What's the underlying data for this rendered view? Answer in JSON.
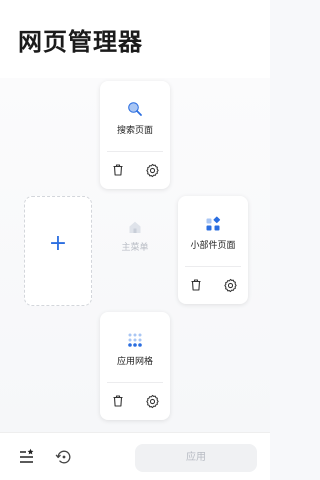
{
  "header": {
    "title": "网页管理器"
  },
  "cards": {
    "search": {
      "label": "搜索页面"
    },
    "widget": {
      "label": "小部件页面"
    },
    "appgrid": {
      "label": "应用网格"
    }
  },
  "home": {
    "label": "主菜单"
  },
  "add_slot": {
    "glyph": "+"
  },
  "bottom_bar": {
    "apply_label": "应用"
  },
  "icons": {
    "search": "search-icon",
    "widget": "widget-icon",
    "appgrid": "app-grid-icon",
    "home": "home-icon",
    "delete": "trash-icon",
    "settings": "gear-icon",
    "list": "list-star-icon",
    "history": "history-icon"
  },
  "colors": {
    "accent": "#2b6ee0",
    "icon_dark": "#333333",
    "disabled_text": "#b8bcc4",
    "disabled_button": "#f0f1f3"
  }
}
